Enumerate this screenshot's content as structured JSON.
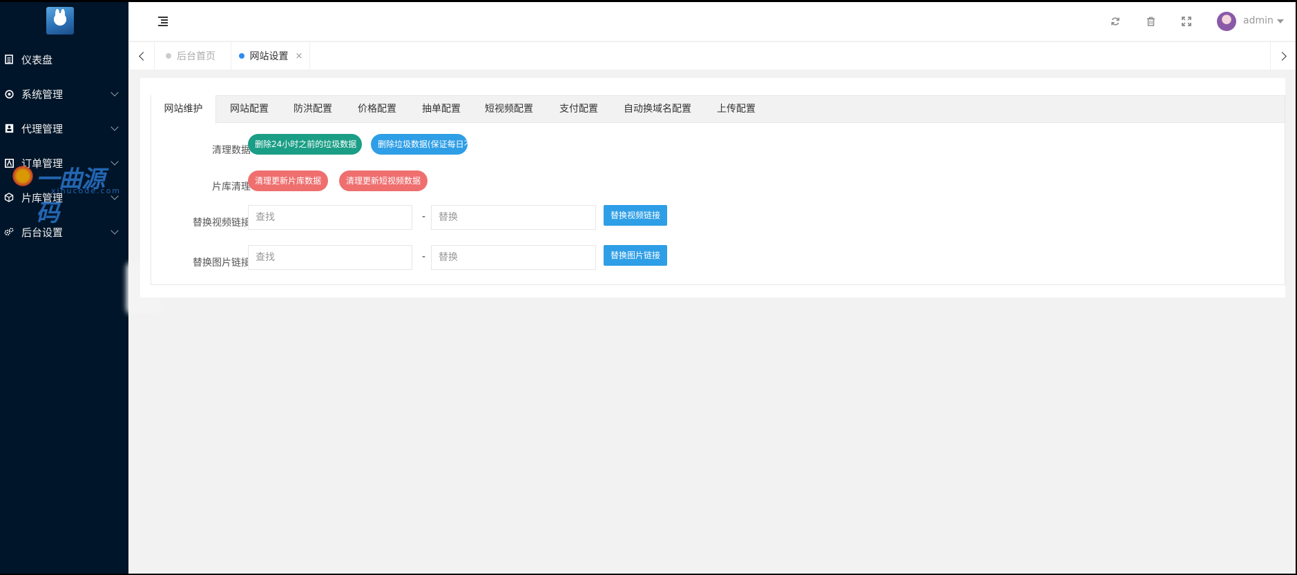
{
  "sidebar": {
    "logo_icon": "bunny-avatar-icon",
    "items": [
      {
        "label": "仪表盘",
        "icon": "clipboard-icon",
        "has_children": false
      },
      {
        "label": "系统管理",
        "icon": "gear-circle-icon",
        "has_children": true
      },
      {
        "label": "代理管理",
        "icon": "user-card-icon",
        "has_children": true
      },
      {
        "label": "订单管理",
        "icon": "order-box-icon",
        "has_children": true
      },
      {
        "label": "片库管理",
        "icon": "cube-icon",
        "has_children": true
      },
      {
        "label": "后台设置",
        "icon": "gears-icon",
        "has_children": true
      }
    ],
    "watermark": {
      "title": "一曲源码",
      "sub": "xinucode.com"
    }
  },
  "header": {
    "toggle_icon": "menu-toggle-icon",
    "refresh_icon": "refresh-icon",
    "trash_icon": "trash-icon",
    "fullscreen_icon": "fullscreen-icon",
    "username": "admin"
  },
  "page_tabs": [
    {
      "label": "后台首页",
      "active": false
    },
    {
      "label": "网站设置",
      "active": true,
      "close": "×"
    }
  ],
  "settings_tabs": [
    "网站维护",
    "网站配置",
    "防洪配置",
    "价格配置",
    "抽单配置",
    "短视频配置",
    "支付配置",
    "自动换域名配置",
    "上传配置"
  ],
  "form": {
    "clear_data": {
      "label": "清理数据",
      "btn1": "删除24小时之前的垃圾数据",
      "btn2": "删除垃圾数据(保证每日不卡)"
    },
    "library_clean": {
      "label": "片库清理",
      "btn1": "清理更新片库数据",
      "btn2": "清理更新短视频数据"
    },
    "replace_video": {
      "label": "替换视频链接",
      "find_placeholder": "查找",
      "replace_placeholder": "替换",
      "separator": "-",
      "button": "替换视频链接"
    },
    "replace_image": {
      "label": "替换图片链接",
      "find_placeholder": "查找",
      "replace_placeholder": "替换",
      "separator": "-",
      "button": "替换图片链接"
    }
  },
  "colors": {
    "sidebar_bg": "#001529",
    "teal": "#1a9e86",
    "blue": "#2e9ee6",
    "red": "#ef6f6f"
  }
}
